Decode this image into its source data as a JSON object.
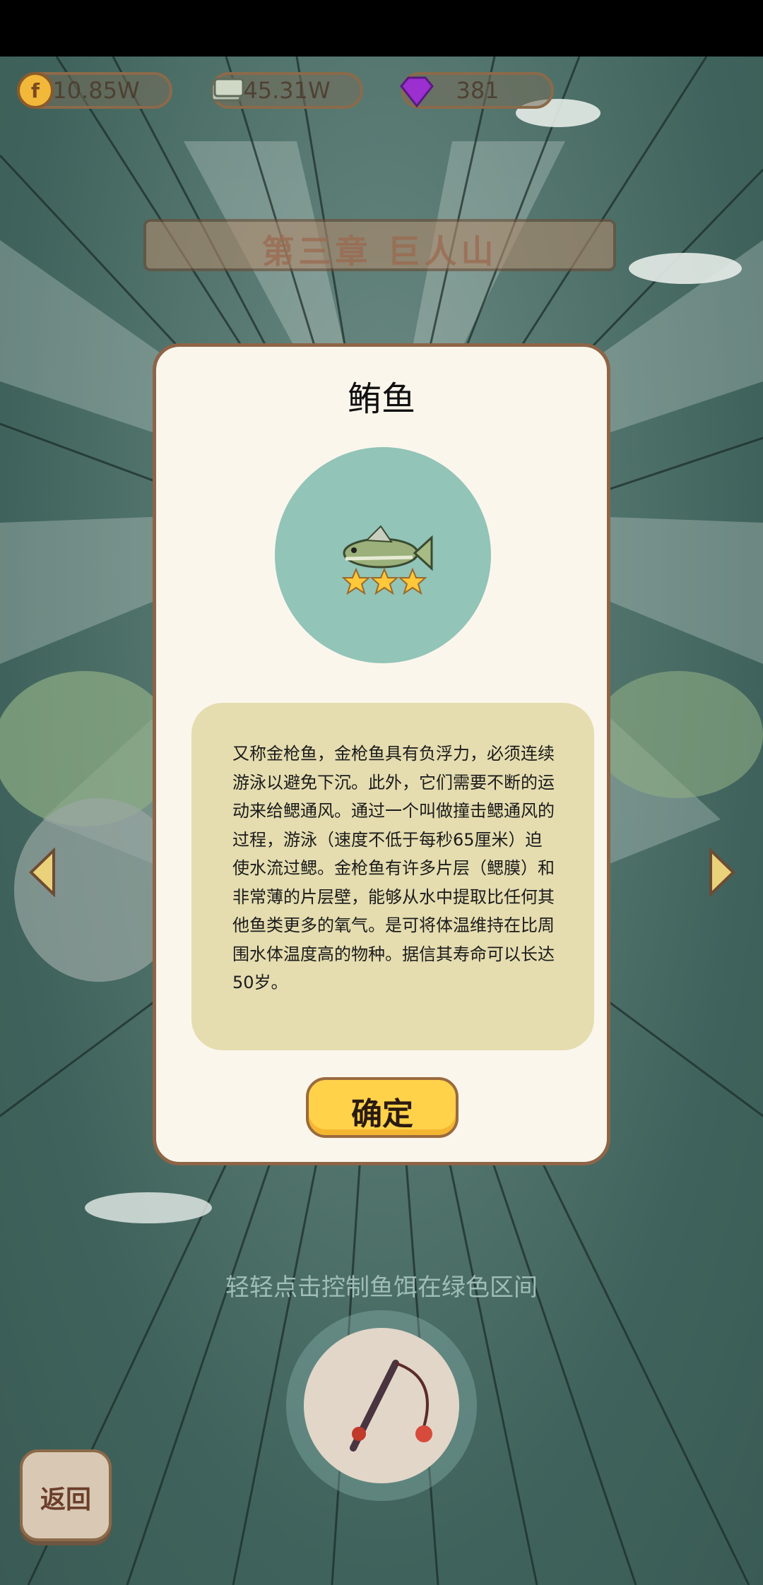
{
  "resources": {
    "coins": "10.85W",
    "cash": "45.31W",
    "gems": "381"
  },
  "chapter_banner": "第三章 巨人山",
  "hint": "轻轻点击控制鱼饵在绿色区间",
  "back_label": "返回",
  "dialog": {
    "title": "鲔鱼",
    "stars": 3,
    "description": "又称金枪鱼，金枪鱼具有负浮力，必须连续游泳以避免下沉。此外，它们需要不断的运动来给鳃通风。通过一个叫做撞击鳃通风的过程，游泳（速度不低于每秒65厘米）迫使水流过鳃。金枪鱼有许多片层（鳃膜）和非常薄的片层壁，能够从水中提取比任何其他鱼类更多的氧气。是可将体温维持在比周围水体温度高的物种。据信其寿命可以长达50岁。",
    "confirm_label": "确定"
  },
  "colors": {
    "dialog_bg": "#fbf6ec",
    "fish_circle": "#92c4b8",
    "desc_bg": "#e5ddb0",
    "confirm_bg": "#ffd24a"
  }
}
